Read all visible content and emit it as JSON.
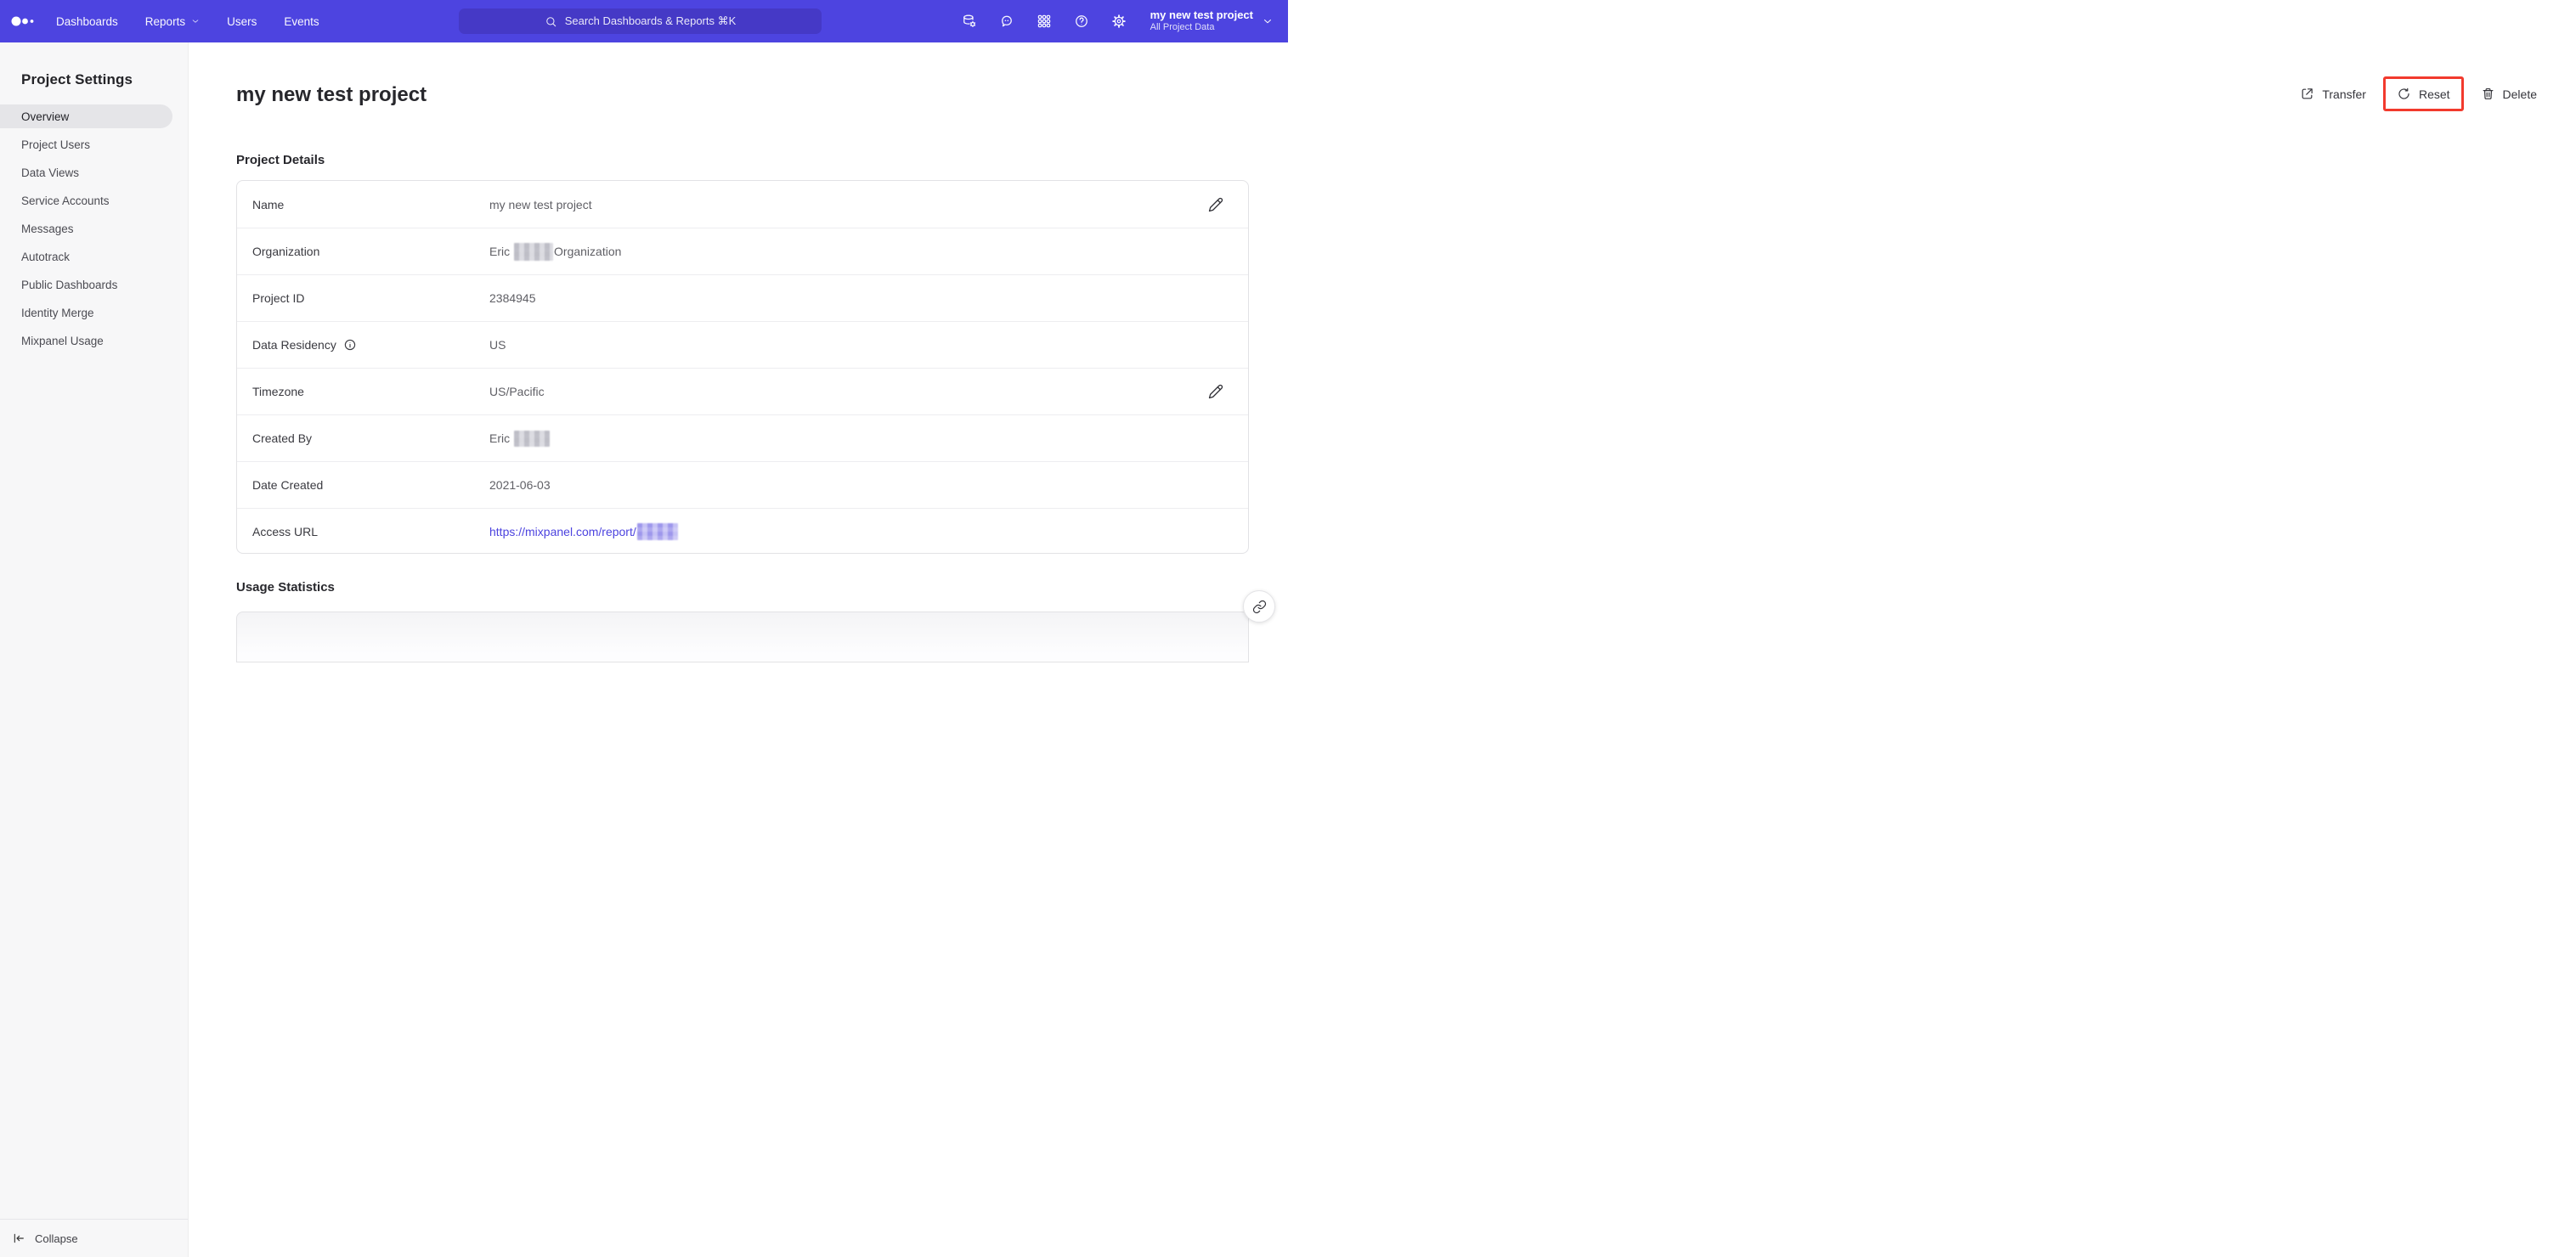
{
  "colors": {
    "topbar_bg": "#4d44e0",
    "search_bg": "#4539c6",
    "accent_link": "#4c43df",
    "highlight_red": "#f23a2d",
    "sidebar_bg": "#f7f7f8",
    "active_item_bg": "#e5e5e8"
  },
  "topbar": {
    "logo_icon": "mixpanel-dots-logo",
    "nav": [
      {
        "label": "Dashboards"
      },
      {
        "label": "Reports",
        "dropdown": true,
        "icon": "chevron-down-icon"
      },
      {
        "label": "Users"
      },
      {
        "label": "Events"
      }
    ],
    "search": {
      "icon": "search-icon",
      "placeholder": "Search Dashboards & Reports ⌘K"
    },
    "icons": [
      {
        "icon": "data-management-icon"
      },
      {
        "icon": "feedback-message-icon"
      },
      {
        "icon": "apps-grid-icon"
      },
      {
        "icon": "help-icon"
      },
      {
        "icon": "settings-gear-icon"
      }
    ],
    "project_selector": {
      "title": "my new test project",
      "subtitle": "All Project Data",
      "icon": "chevron-down-icon"
    }
  },
  "sidebar": {
    "title": "Project Settings",
    "items": [
      {
        "label": "Overview",
        "active": true
      },
      {
        "label": "Project Users"
      },
      {
        "label": "Data Views"
      },
      {
        "label": "Service Accounts"
      },
      {
        "label": "Messages"
      },
      {
        "label": "Autotrack"
      },
      {
        "label": "Public Dashboards"
      },
      {
        "label": "Identity Merge"
      },
      {
        "label": "Mixpanel Usage"
      }
    ],
    "collapse_label": "Collapse",
    "collapse_icon": "collapse-left-icon"
  },
  "main": {
    "page_title": "my new test project",
    "actions": [
      {
        "label": "Transfer",
        "icon": "transfer-icon"
      },
      {
        "label": "Reset",
        "icon": "reset-icon",
        "highlighted": true
      },
      {
        "label": "Delete",
        "icon": "trash-icon"
      }
    ],
    "details": {
      "heading": "Project Details",
      "rows": [
        {
          "label": "Name",
          "value": "my new test project",
          "editable": true
        },
        {
          "label": "Organization",
          "value_prefix": "Eric",
          "value_suffix": "Organization",
          "redacted": true
        },
        {
          "label": "Project ID",
          "value": "2384945"
        },
        {
          "label": "Data Residency",
          "value": "US",
          "info_icon": "info-icon"
        },
        {
          "label": "Timezone",
          "value": "US/Pacific",
          "editable": true
        },
        {
          "label": "Created By",
          "value_prefix": "Eric",
          "redacted": true
        },
        {
          "label": "Date Created",
          "value": "2021-06-03"
        },
        {
          "label": "Access URL",
          "link_text": "https://mixpanel.com/report/",
          "redacted": true
        }
      ]
    },
    "usage": {
      "heading": "Usage Statistics"
    },
    "floating_button_icon": "link-icon"
  }
}
